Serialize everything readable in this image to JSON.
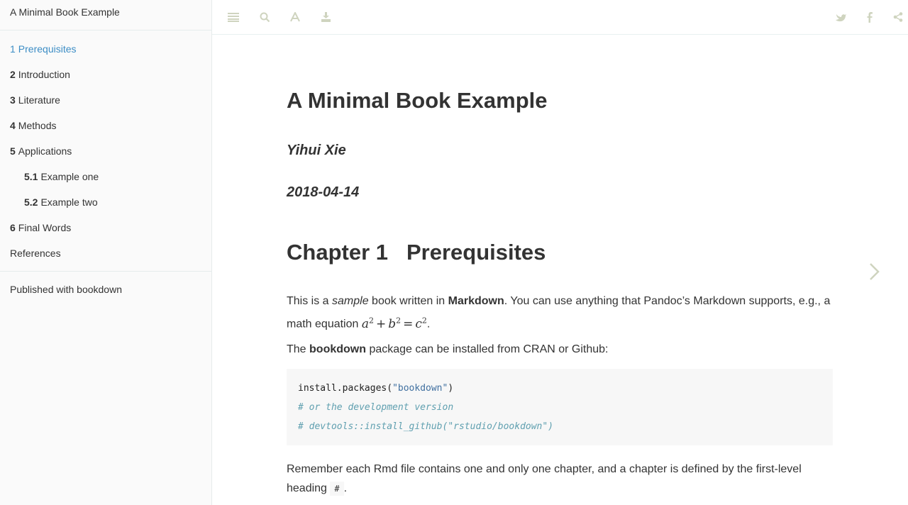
{
  "sidebar": {
    "title": "A Minimal Book Example",
    "items": [
      {
        "num": "1",
        "label": "Prerequisites",
        "active": true,
        "level": 1
      },
      {
        "num": "2",
        "label": "Introduction",
        "level": 1
      },
      {
        "num": "3",
        "label": "Literature",
        "level": 1
      },
      {
        "num": "4",
        "label": "Methods",
        "level": 1
      },
      {
        "num": "5",
        "label": "Applications",
        "level": 1
      },
      {
        "num": "5.1",
        "label": "Example one",
        "level": 2
      },
      {
        "num": "5.2",
        "label": "Example two",
        "level": 2
      },
      {
        "num": "6",
        "label": "Final Words",
        "level": 1
      },
      {
        "num": "",
        "label": "References",
        "level": 1
      }
    ],
    "footer": "Published with bookdown",
    "active_color": "#3c8dc5"
  },
  "toolbar": {
    "left_icons": [
      "menu-icon",
      "search-icon",
      "font-settings-icon",
      "download-icon"
    ],
    "right_icons": [
      "twitter-icon",
      "facebook-icon",
      "share-icon"
    ],
    "icon_color": "#cfd4bf"
  },
  "content": {
    "title": "A Minimal Book Example",
    "author": "Yihui Xie",
    "date": "2018-04-14",
    "chapter": {
      "number": "Chapter 1",
      "title": "Prerequisites"
    },
    "p1": {
      "t1": "This is a ",
      "em": "sample",
      "t2": " book written in ",
      "strong": "Markdown",
      "t3": ". You can use anything that Pandoc’s Markdown supports, e.g., a math equation ",
      "math": {
        "a": "a",
        "b": "b",
        "c": "c",
        "exp": "2",
        "plus": "+",
        "eq": "="
      },
      "t4": "."
    },
    "p2": {
      "t1": "The ",
      "strong": "bookdown",
      "t2": " package can be installed from CRAN or Github:"
    },
    "code": {
      "line1_fn": "install.packages(",
      "line1_str": "\"bookdown\"",
      "line1_end": ")",
      "line2": "# or the development version",
      "line3": "# devtools::install_github(\"rstudio/bookdown\")"
    },
    "p3": {
      "t1": "Remember each Rmd file contains one and only one chapter, and a chapter is defined by the first-level heading ",
      "code": "#",
      "t2": "."
    }
  }
}
